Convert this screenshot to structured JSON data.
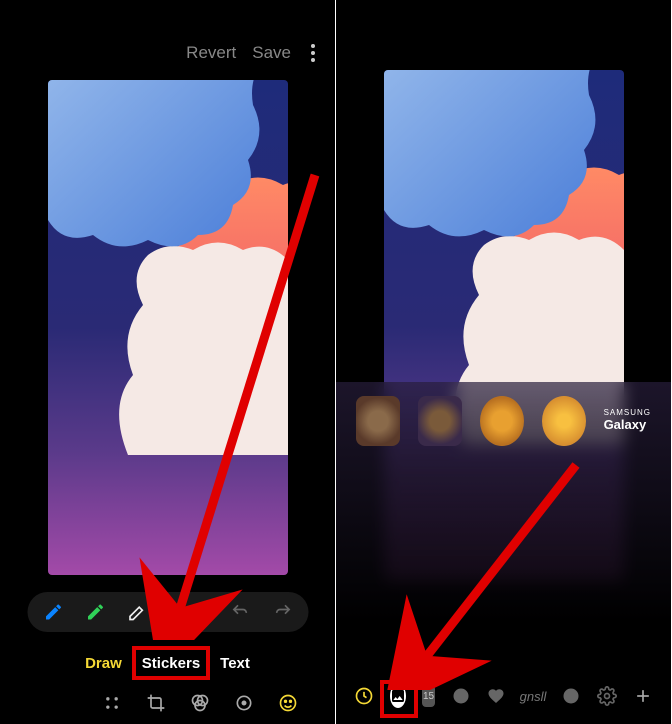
{
  "left": {
    "topbar": {
      "revert": "Revert",
      "save": "Save"
    },
    "modes": {
      "draw": "Draw",
      "stickers": "Stickers",
      "text": "Text"
    }
  },
  "right": {
    "brand": {
      "samsung": "SAMSUNG",
      "galaxy": "Galaxy"
    },
    "calendar_day": "15"
  }
}
